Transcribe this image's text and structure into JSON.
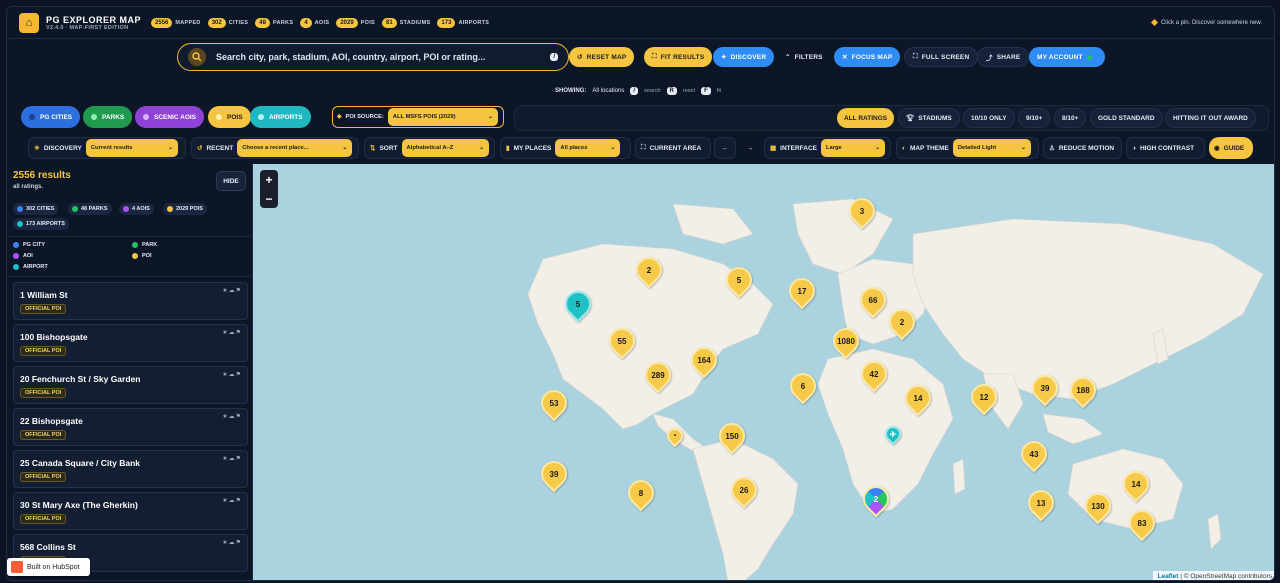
{
  "header": {
    "title": "PG EXPLORER MAP",
    "subtitle": "V2.4.0 · MAP-FIRST EDITION",
    "stats": [
      {
        "n": "2556",
        "label": "MAPPED"
      },
      {
        "n": "302",
        "label": "CITIES"
      },
      {
        "n": "48",
        "label": "PARKS"
      },
      {
        "n": "4",
        "label": "AOIS"
      },
      {
        "n": "2029",
        "label": "POIS"
      },
      {
        "n": "81",
        "label": "STADIUMS"
      },
      {
        "n": "173",
        "label": "AIRPORTS"
      }
    ],
    "hint": "Click a pin. Discover somewhere new."
  },
  "search": {
    "placeholder": "Search city, park, stadium, AOI, country, airport, POI or rating...",
    "shortcut": "/"
  },
  "toolbar": {
    "reset": "RESET MAP",
    "fit": "FIT RESULTS",
    "discover": "DISCOVER",
    "filters": "FILTERS",
    "focus": "FOCUS MAP",
    "fullscreen": "FULL SCREEN",
    "share": "SHARE",
    "account": "MY ACCOUNT"
  },
  "showing": {
    "label": "SHOWING:",
    "value": "All locations",
    "k1": "/",
    "k1l": "search",
    "k2": "R",
    "k2l": "reset",
    "k3": "F",
    "k3l": "fit"
  },
  "types": [
    {
      "label": "PG CITIES",
      "color": "#3b82f6"
    },
    {
      "label": "PARKS",
      "color": "#22c55e"
    },
    {
      "label": "SCENIC AOIS",
      "color": "#a855f7"
    },
    {
      "label": "POIS",
      "color": "#f5c542"
    },
    {
      "label": "AIRPORTS",
      "color": "#1fc1c6"
    }
  ],
  "poi_source": {
    "label": "POI SOURCE:",
    "value": "ALL MSFS POIS (2029)"
  },
  "ratings": [
    "ALL RATINGS",
    "STADIUMS",
    "10/10 ONLY",
    "9/10+",
    "8/10+",
    "GOLD STANDARD",
    "HITTING IT OUT AWARD"
  ],
  "controls": {
    "discovery": "DISCOVERY",
    "discovery_val": "Current results",
    "recent": "RECENT",
    "recent_val": "Choose a recent place...",
    "sort": "SORT",
    "sort_val": "Alphabetical A–Z",
    "my_places": "MY PLACES",
    "my_places_val": "All places",
    "current_area": "CURRENT AREA",
    "prev": "←",
    "next": "→",
    "interface": "INTERFACE",
    "interface_val": "Large",
    "theme": "MAP THEME",
    "theme_val": "Detailed Light",
    "reduce_motion": "REDUCE MOTION",
    "high_contrast": "HIGH CONTRAST",
    "guide": "GUIDE"
  },
  "sidebar": {
    "count": "2556 results",
    "sub": "all ratings.",
    "hide": "HIDE",
    "pills": [
      {
        "label": "302 CITIES",
        "color": "#3b82f6"
      },
      {
        "label": "48 PARKS",
        "color": "#22c55e"
      },
      {
        "label": "4 AOIS",
        "color": "#a855f7"
      },
      {
        "label": "2029 POIS",
        "color": "#f5c542"
      },
      {
        "label": "173 AIRPORTS",
        "color": "#1fc1c6"
      }
    ],
    "legend": [
      {
        "label": "PG CITY",
        "color": "#3b82f6"
      },
      {
        "label": "PARK",
        "color": "#22c55e"
      },
      {
        "label": "AOI",
        "color": "#a855f7"
      },
      {
        "label": "POI",
        "color": "#f5c542"
      },
      {
        "label": "AIRPORT",
        "color": "#1fc1c6"
      }
    ],
    "tag": "OFFICIAL POI",
    "items": [
      "1 William St",
      "100 Bishopsgate",
      "20 Fenchurch St / Sky Garden",
      "22 Bishopsgate",
      "25 Canada Square / City Bank",
      "30 St Mary Axe (The Gherkin)",
      "568 Collins St"
    ]
  },
  "map": {
    "clusters": [
      "3",
      "2",
      "5",
      "17",
      "66",
      "2",
      "5",
      "55",
      "1080",
      "164",
      "289",
      "42",
      "6",
      "14",
      "12",
      "39",
      "188",
      "53",
      "150",
      "43",
      "39",
      "8",
      "26",
      "2",
      "14",
      "13",
      "130",
      "83"
    ],
    "attribution_leaflet": "Leaflet",
    "attribution_rest": " | © OpenStreetMap contributors"
  },
  "hubspot": "Built on HubSpot"
}
